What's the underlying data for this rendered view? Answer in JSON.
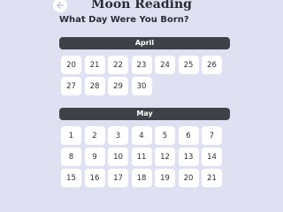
{
  "header": {
    "title": "Moon Reading",
    "back_icon": "arrow-left-icon"
  },
  "question": "What Day Were You Born?",
  "months": [
    {
      "name": "April",
      "days": [
        "20",
        "21",
        "22",
        "23",
        "24",
        "25",
        "26",
        "27",
        "28",
        "29",
        "30"
      ]
    },
    {
      "name": "May",
      "days": [
        "1",
        "2",
        "3",
        "4",
        "5",
        "6",
        "7",
        "8",
        "9",
        "10",
        "11",
        "12",
        "13",
        "14",
        "15",
        "16",
        "17",
        "18",
        "19",
        "20",
        "21"
      ]
    }
  ],
  "colors": {
    "background": "#dfe1f2",
    "month_header": "#3f4148",
    "day_tile": "#ffffff",
    "text": "#2b2b35"
  }
}
